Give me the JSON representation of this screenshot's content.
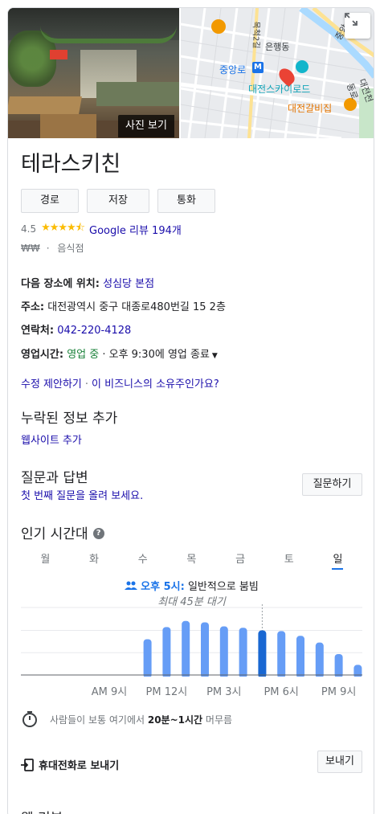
{
  "hero": {
    "photo_button": "사진 보기",
    "map_labels": {
      "l1": "은행동",
      "l2": "중앙로",
      "l3": "대전스카이로드",
      "l4": "대전갈비집",
      "l5": "중앙",
      "l6": "대전천동로",
      "l7": "목척2길",
      "metro": "M"
    }
  },
  "place": {
    "name": "테라스키친",
    "actions": [
      "경로",
      "저장",
      "통화"
    ],
    "rating": "4.5",
    "review_link": "Google 리뷰 194개",
    "price": "₩₩",
    "dot": "·",
    "category": "음식점"
  },
  "info": {
    "located_label": "다음 장소에 위치:",
    "located_value": "성심당 본점",
    "address_label": "주소:",
    "address_value": "대전광역시 중구 대종로480번길 15 2층",
    "phone_label": "연락처:",
    "phone_value": "042-220-4128",
    "hours_label": "영업시간:",
    "hours_status": "영업 중",
    "hours_detail": "· 오후 9:30에 영업 종료"
  },
  "edit": {
    "suggest": "수정 제안하기",
    "sep": "·",
    "owner": "이 비즈니스의 소유주인가요?"
  },
  "missing": {
    "title": "누락된 정보 추가",
    "link": "웹사이트 추가"
  },
  "qa": {
    "title": "질문과 답변",
    "link": "첫 번째 질문을 올려 보세요.",
    "button": "질문하기"
  },
  "popular": {
    "title": "인기 시간대",
    "help": "?",
    "days": [
      "월",
      "화",
      "수",
      "목",
      "금",
      "토",
      "일"
    ],
    "active_day": 6,
    "live_now": "오후 5시:",
    "live_text": "일반적으로 붐빔",
    "wait": "최대 45분 대기",
    "visit_prefix": "사람들이 보통 여기에서",
    "visit_bold": "20분~1시간",
    "visit_suffix": "머무름"
  },
  "chart_data": {
    "type": "bar",
    "categories": [
      "9시",
      "10시",
      "11시",
      "12시",
      "13시",
      "14시",
      "15시",
      "16시",
      "17시",
      "18시",
      "19시",
      "20시",
      "21시",
      "22시"
    ],
    "values": [
      0,
      0,
      0,
      0,
      0,
      0,
      0,
      0,
      0,
      0,
      0,
      0,
      0,
      0
    ],
    "bars": [
      {
        "hour": 9,
        "value": 0
      },
      {
        "hour": 10,
        "value": 0
      },
      {
        "hour": 11,
        "value": 53
      },
      {
        "hour": 12,
        "value": 71
      },
      {
        "hour": 13,
        "value": 80
      },
      {
        "hour": 14,
        "value": 78
      },
      {
        "hour": 15,
        "value": 72
      },
      {
        "hour": 16,
        "value": 70
      },
      {
        "hour": 17,
        "value": 66
      },
      {
        "hour": 18,
        "value": 65
      },
      {
        "hour": 19,
        "value": 58
      },
      {
        "hour": 20,
        "value": 48
      },
      {
        "hour": 21,
        "value": 31
      },
      {
        "hour": 22,
        "value": 15
      }
    ],
    "current_hour": 17,
    "tick_labels": [
      "AM 9시",
      "PM 12시",
      "PM 3시",
      "PM 6시",
      "PM 9시"
    ],
    "ylim": [
      0,
      100
    ],
    "colors": {
      "bar": "#669df6",
      "current": "#1967d2",
      "grid": "#e8eaed"
    }
  },
  "send": {
    "label": "휴대전화로 보내기",
    "button": "보내기"
  },
  "web_reviews": {
    "title": "웹 리뷰"
  }
}
